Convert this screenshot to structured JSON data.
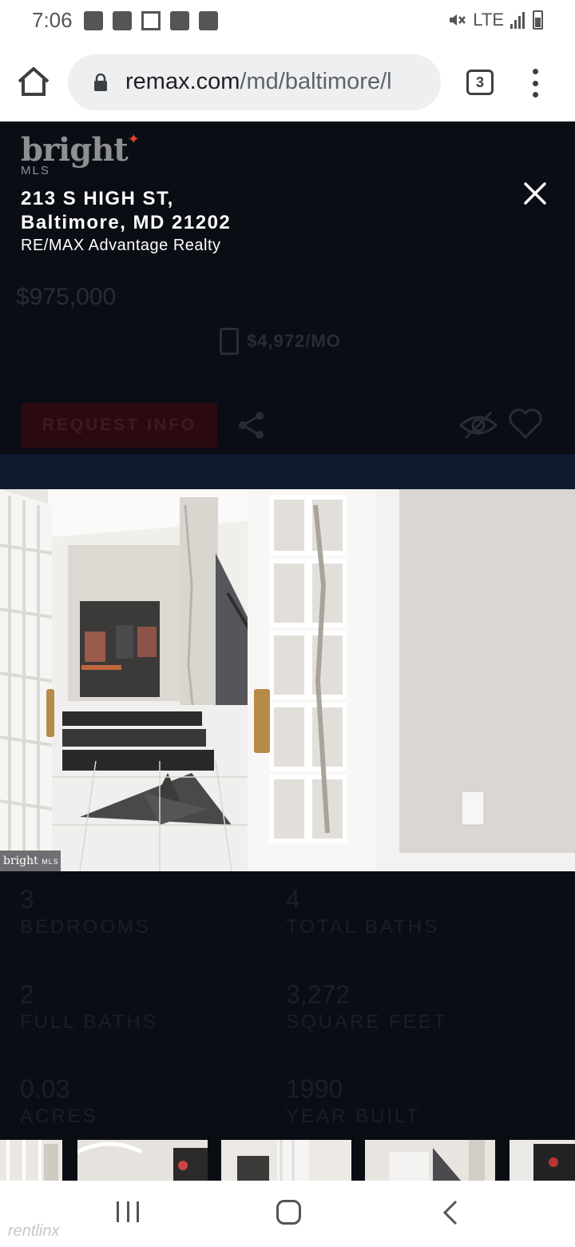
{
  "status_bar": {
    "time": "7:06",
    "network": "LTE",
    "icons_left": [
      "message-icon",
      "square-icon",
      "missed-call-icon",
      "image-icon",
      "cast-icon"
    ],
    "icons_right": [
      "mute-icon",
      "signal-icon",
      "battery-icon"
    ]
  },
  "browser": {
    "url_domain": "remax.com",
    "url_path": "/md/baltimore/l",
    "tab_count": "3"
  },
  "listing": {
    "logo_text": "bright",
    "logo_sub": "MLS",
    "address_line1": "213 S HIGH ST,",
    "address_line2": "Baltimore, MD 21202",
    "brokerage": "RE/MAX Advantage Realty",
    "price": "$975,000",
    "mortgage": "$4,972/MO",
    "request_button": "REQUEST INFO",
    "photo_watermark": "bright",
    "photo_watermark_sub": "MLS"
  },
  "stats": [
    {
      "value": "3",
      "label": "BEDROOMS"
    },
    {
      "value": "4",
      "label": "TOTAL BATHS"
    },
    {
      "value": "2",
      "label": "FULL BATHS"
    },
    {
      "value": "3,272",
      "label": "SQUARE FEET"
    },
    {
      "value": "0.03",
      "label": "ACRES"
    },
    {
      "value": "1990",
      "label": "YEAR BUILT"
    }
  ],
  "footer_watermark": "rentlinx",
  "colors": {
    "overlay_bg": "#0b0d14",
    "request_red": "#2a0a10",
    "logo_accent": "#e3432b"
  }
}
